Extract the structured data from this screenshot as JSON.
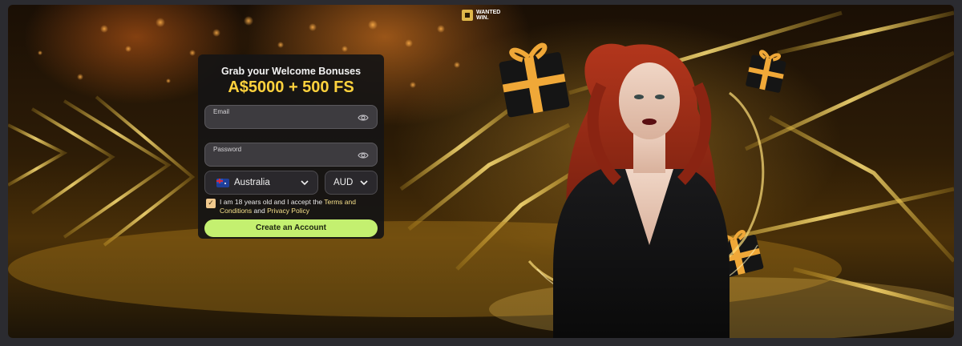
{
  "brand": {
    "logo_text_line1": "WANTED",
    "logo_text_line2": "WIN."
  },
  "signup": {
    "title": "Grab your Welcome Bonuses",
    "bonus": "A$5000 + 500 FS",
    "email": {
      "label": "Email",
      "value": ""
    },
    "password": {
      "label": "Password",
      "value": ""
    },
    "country": {
      "selected": "Australia",
      "flag_icon": "australia-flag-icon"
    },
    "currency": {
      "selected": "AUD"
    },
    "consent": {
      "checked": true,
      "text_before": "I am 18 years old and I accept the ",
      "terms_link": "Terms and Conditions",
      "text_mid": " and ",
      "privacy_link": "Privacy Policy"
    },
    "cta_label": "Create an Account"
  },
  "colors": {
    "bonus_yellow": "#ffd23d",
    "cta_green": "#c4f070",
    "link_yellow": "#f5e08a",
    "card_bg": "#161414",
    "field_bg": "#3d3b3f"
  }
}
